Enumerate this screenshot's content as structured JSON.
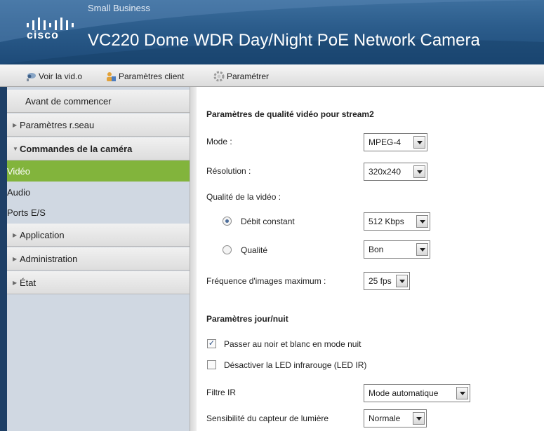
{
  "header": {
    "brand": "Small Business",
    "logo_text": "cisco",
    "title": "VC220 Dome WDR Day/Night PoE Network Camera"
  },
  "toolbar": {
    "items": [
      {
        "label": "Voir la vid.o",
        "icon": "camera-icon"
      },
      {
        "label": "Paramètres client",
        "icon": "user-settings-icon"
      },
      {
        "label": "Paramétrer",
        "icon": "gear-icon"
      }
    ]
  },
  "sidebar": {
    "items": [
      {
        "label": "Avant de commencer",
        "type": "section"
      },
      {
        "label": "Paramètres r.seau",
        "type": "section",
        "expanded": false
      },
      {
        "label": "Commandes de la caméra",
        "type": "section",
        "expanded": true
      },
      {
        "label": "Vidéo",
        "type": "sub",
        "active": true
      },
      {
        "label": "Audio",
        "type": "sub"
      },
      {
        "label": "Ports E/S",
        "type": "sub"
      },
      {
        "label": "Application",
        "type": "section",
        "expanded": false
      },
      {
        "label": "Administration",
        "type": "section",
        "expanded": false
      },
      {
        "label": "État",
        "type": "section",
        "expanded": false
      }
    ]
  },
  "content": {
    "quality_title": "Paramètres de qualité vidéo pour stream2",
    "mode": {
      "label": "Mode :",
      "value": "MPEG-4"
    },
    "resolution": {
      "label": "Résolution :",
      "value": "320x240"
    },
    "video_quality_label": "Qualité de la vidéo :",
    "constant_bitrate": {
      "label": "Débit constant",
      "value": "512 Kbps",
      "selected": true
    },
    "quality": {
      "label": "Qualité",
      "value": "Bon",
      "selected": false
    },
    "max_frame_rate": {
      "label": "Fréquence d'images maximum :",
      "value": "25 fps"
    },
    "day_night_title": "Paramètres jour/nuit",
    "bw_night": {
      "label": "Passer au noir et blanc en mode nuit",
      "checked": true
    },
    "disable_ir_led": {
      "label": "Désactiver la LED infrarouge (LED IR)",
      "checked": false
    },
    "ir_filter": {
      "label": "Filtre IR",
      "value": "Mode automatique"
    },
    "light_sensor": {
      "label": "Sensibilité du capteur de lumière",
      "value": "Normale"
    }
  },
  "colors": {
    "header": "#2c5d8c",
    "active_nav": "#82b43c",
    "sidebar": "#d0d8e2"
  }
}
